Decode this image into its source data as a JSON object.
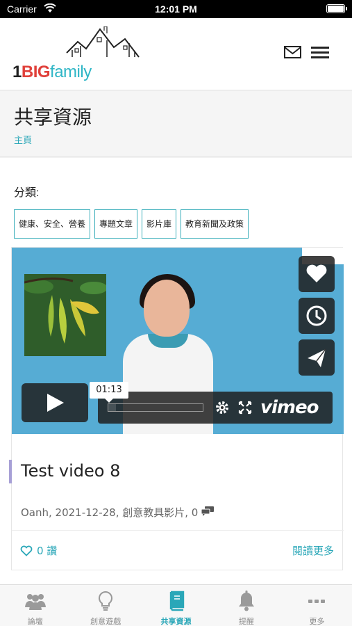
{
  "status_bar": {
    "carrier": "Carrier",
    "time": "12:01 PM"
  },
  "header": {
    "logo": {
      "one": "1",
      "big": "BIG",
      "family": "family"
    }
  },
  "page": {
    "title": "共享資源",
    "breadcrumb": "主頁"
  },
  "categories": {
    "label": "分類:",
    "tags": [
      "健康、安全、營養",
      "專題文章",
      "影片庫",
      "教育新聞及政策"
    ]
  },
  "post": {
    "video": {
      "time_tooltip": "01:13",
      "brand": "vimeo",
      "progress": 0.08
    },
    "title": "Test video 8",
    "meta": "Oanh, 2021-12-28, 創意教具影片, 0",
    "likes": "0 讚",
    "read_more": "閱讀更多"
  },
  "tab_bar": {
    "active_index": 2,
    "items": [
      {
        "label": "論壇",
        "icon": "users-icon"
      },
      {
        "label": "創意遊戲",
        "icon": "lightbulb-icon"
      },
      {
        "label": "共享資源",
        "icon": "book-icon"
      },
      {
        "label": "提醒",
        "icon": "bell-icon"
      },
      {
        "label": "更多",
        "icon": "more-dots-icon"
      }
    ]
  },
  "colors": {
    "accent": "#2aa7b8",
    "video_bg": "#56acd4",
    "title_bar": "#a7a0d6"
  }
}
